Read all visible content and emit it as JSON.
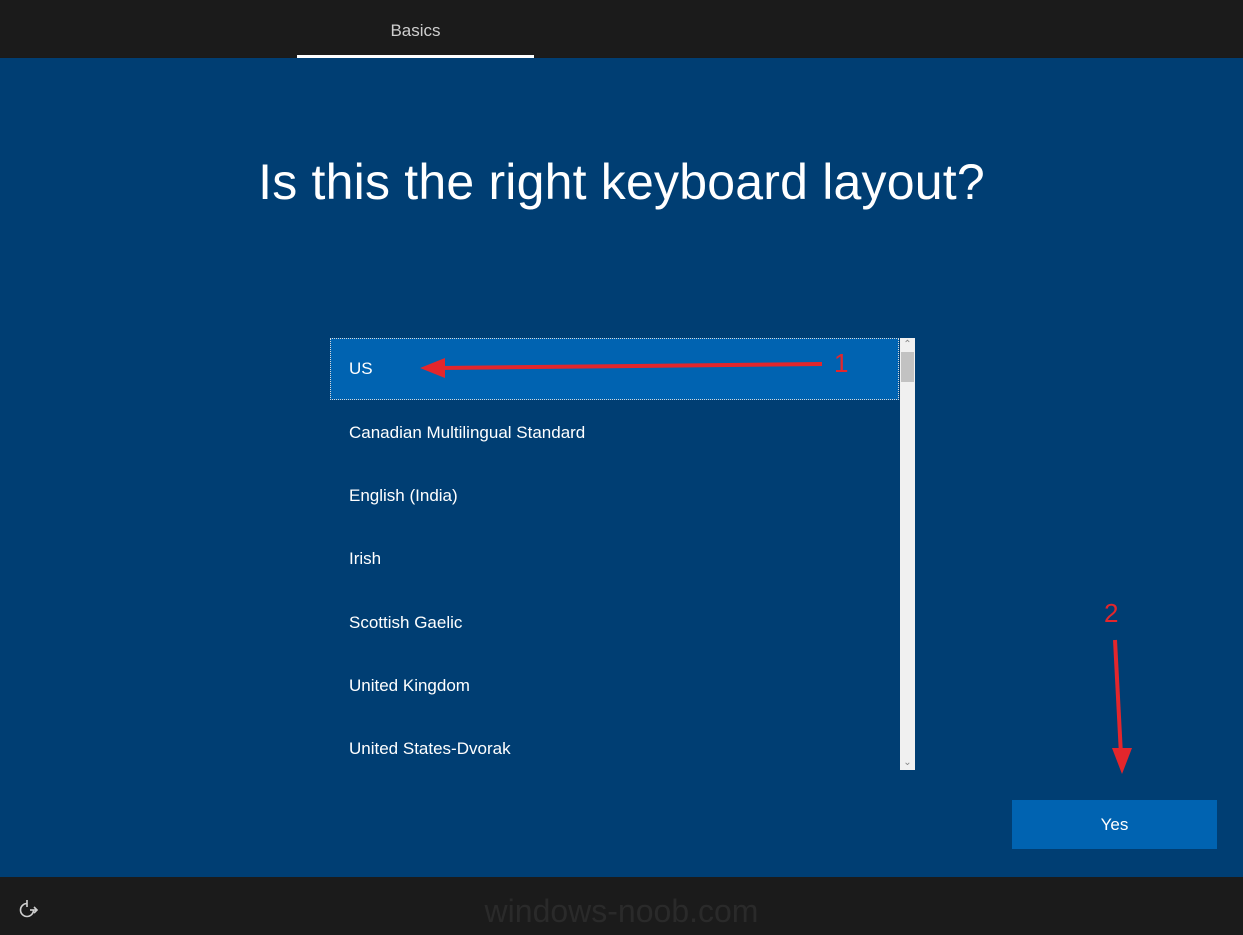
{
  "header": {
    "tab_label": "Basics"
  },
  "main": {
    "title": "Is this the right keyboard layout?",
    "layouts": [
      {
        "label": "US",
        "selected": true
      },
      {
        "label": "Canadian Multilingual Standard",
        "selected": false
      },
      {
        "label": "English (India)",
        "selected": false
      },
      {
        "label": "Irish",
        "selected": false
      },
      {
        "label": "Scottish Gaelic",
        "selected": false
      },
      {
        "label": "United Kingdom",
        "selected": false
      },
      {
        "label": "United States-Dvorak",
        "selected": false
      }
    ],
    "yes_label": "Yes"
  },
  "annotations": {
    "step1": "1",
    "step2": "2",
    "arrow_color": "#e3262c"
  },
  "footer": {
    "accessibility_icon": "ease-of-access-icon",
    "watermark": "windows-noob.com"
  },
  "colors": {
    "background": "#003e73",
    "accent": "#0063b1",
    "bar": "#1b1b1b"
  }
}
